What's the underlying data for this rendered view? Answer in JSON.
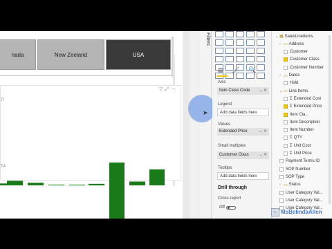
{
  "slicer": {
    "buttons": [
      {
        "label": "nada",
        "selected": false
      },
      {
        "label": "New Zeeland",
        "selected": false
      },
      {
        "label": "USA",
        "selected": true
      }
    ]
  },
  "visual": {
    "fragment_top": "T!",
    "fragment_mid": "T4"
  },
  "chart_data": {
    "type": "bar",
    "bars": [
      {
        "pos": 1,
        "value": 0.5
      },
      {
        "pos": 2,
        "value": 1.2
      },
      {
        "pos": 3,
        "value": 0.7
      },
      {
        "pos": 4,
        "value": 0.2
      },
      {
        "pos": 5,
        "value": 0.2
      },
      {
        "pos": 6,
        "value": 0.4
      },
      {
        "pos": 7,
        "value": 6.0
      },
      {
        "pos": 8,
        "value": 1.0
      },
      {
        "pos": 9,
        "value": 4.2
      },
      {
        "pos": 7,
        "value": -13.5
      }
    ],
    "ylim": [
      -14,
      8
    ],
    "color": "#1a7a1a"
  },
  "filters": {
    "label": "Filters"
  },
  "viz": {
    "icons": [
      "bar",
      "col",
      "stk",
      "clu",
      "ln",
      "area",
      "a2",
      "r",
      "cmb",
      "wf",
      "scat",
      "pie",
      "dnt",
      "tre",
      "map",
      "fm",
      "fun",
      "gau",
      "card",
      "kpi",
      "tbl",
      "mtx",
      "py",
      "R",
      "q",
      "key",
      "dec",
      "qa",
      "sm",
      "..."
    ],
    "tools": [
      "fields-tool-icon",
      "format-tool-icon",
      "analytics-tool-icon"
    ],
    "wells": {
      "axis_label": "Axis",
      "axis_value": "Item Class Code",
      "legend_label": "Legend",
      "legend_placeholder": "Add data fields here",
      "values_label": "Values",
      "values_value": "Extended Price",
      "small_multiples_label": "Small multiples",
      "small_multiples_value": "Customer Class",
      "tooltips_label": "Tooltips",
      "tooltips_placeholder": "Add data fields here"
    },
    "drill": {
      "title": "Drill through",
      "cross_report": "Cross-report",
      "toggle_state": "Off"
    }
  },
  "fields": {
    "rows": [
      {
        "text": "SalesLineItems",
        "kind": "table",
        "indent": 0,
        "chev": "v"
      },
      {
        "text": "Address",
        "kind": "folder",
        "indent": 1,
        "chev": ">"
      },
      {
        "text": "Customer",
        "kind": "field",
        "indent": 2,
        "checked": false
      },
      {
        "text": "Customer Class",
        "kind": "field",
        "indent": 2,
        "checked": true
      },
      {
        "text": "Customer Number",
        "kind": "field",
        "indent": 2,
        "checked": false
      },
      {
        "text": "Dates",
        "kind": "folder",
        "indent": 1,
        "chev": ">"
      },
      {
        "text": "Hold",
        "kind": "field",
        "indent": 2,
        "checked": false
      },
      {
        "text": "Line Items",
        "kind": "folder",
        "indent": 1,
        "chev": "v"
      },
      {
        "text": "Extended Cost",
        "kind": "measure",
        "indent": 2,
        "checked": false
      },
      {
        "text": "Extended Price",
        "kind": "measure",
        "indent": 2,
        "checked": true
      },
      {
        "text": "Item Cla...",
        "kind": "field",
        "indent": 2,
        "checked": true
      },
      {
        "text": "Item Description",
        "kind": "field",
        "indent": 2,
        "checked": false
      },
      {
        "text": "Item Number",
        "kind": "field",
        "indent": 2,
        "checked": false
      },
      {
        "text": "QTY",
        "kind": "measure",
        "indent": 2,
        "checked": false
      },
      {
        "text": "Unit Cost",
        "kind": "measure",
        "indent": 2,
        "checked": false
      },
      {
        "text": "Unit Price",
        "kind": "measure",
        "indent": 2,
        "checked": false
      },
      {
        "text": "Payment Terms ID",
        "kind": "field",
        "indent": 1,
        "checked": false
      },
      {
        "text": "SOP Number",
        "kind": "field",
        "indent": 1,
        "checked": false
      },
      {
        "text": "SOP Type",
        "kind": "field",
        "indent": 1,
        "checked": false
      },
      {
        "text": "Status",
        "kind": "folder",
        "indent": 1,
        "chev": ">"
      },
      {
        "text": "User Category Val...",
        "kind": "field",
        "indent": 1,
        "checked": false
      },
      {
        "text": "User Category Val...",
        "kind": "field",
        "indent": 1,
        "checked": false
      },
      {
        "text": "User Category Val...",
        "kind": "field",
        "indent": 1,
        "checked": false
      }
    ]
  },
  "watermark": {
    "text": "MsBelindaAllen"
  }
}
